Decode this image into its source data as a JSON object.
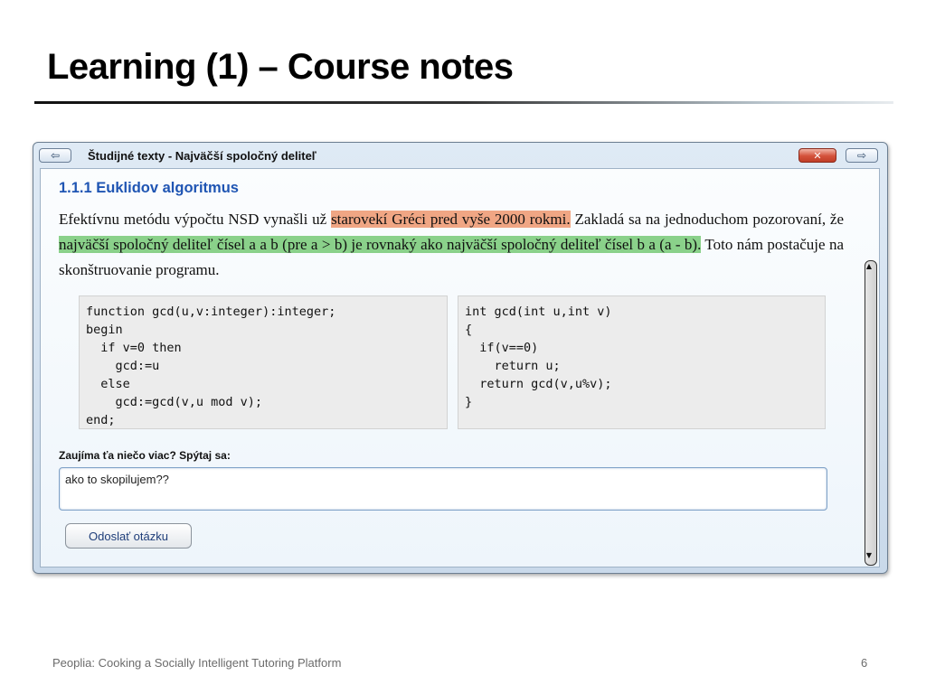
{
  "slide": {
    "title": "Learning (1) – Course notes"
  },
  "window": {
    "title": "Študijné texty - Najväčší spoločný deliteľ",
    "nav_back_icon": "arrow-left-icon",
    "nav_back_glyph": "⇦",
    "close_icon": "close-icon",
    "close_glyph": "✕",
    "nav_forward_icon": "arrow-right-icon",
    "nav_forward_glyph": "⇨"
  },
  "content": {
    "heading": "1.1.1 Euklidov algoritmus",
    "paragraph": {
      "part1": "Efektívnu metódu výpočtu NSD vynašli už ",
      "highlight1": "starovekí Gréci pred vyše 2000 rokmi.",
      "part2": " Zakladá sa na jednoduchom pozorovaní, že ",
      "highlight2": "najväčší spoločný deliteľ čísel a a b (pre a > b) je rovnaký ako najväčší spoločný deliteľ čísel b a (a - b).",
      "part3": " Toto nám postačuje na skonštruovanie programu."
    },
    "highlight_colors": {
      "orange": "#f0a684",
      "green": "#8ad18a"
    },
    "code_pascal": "function gcd(u,v:integer):integer;\nbegin\n  if v=0 then\n    gcd:=u\n  else\n    gcd:=gcd(v,u mod v);\nend;",
    "code_c": "int gcd(int u,int v)\n{\n  if(v==0)\n    return u;\n  return gcd(v,u%v);\n}",
    "question_label": "Zaujíma ťa niečo viac? Spýtaj sa:",
    "question_value": "ako to skopilujem??",
    "submit_label": "Odoslať otázku"
  },
  "scrollbar": {
    "up_glyph": "▲",
    "down_glyph": "▼"
  },
  "footer": {
    "text": "Peoplia: Cooking a Socially Intelligent Tutoring Platform",
    "page": "6"
  },
  "colors": {
    "heading_blue": "#1f55b3",
    "close_red": "#d3513a"
  }
}
